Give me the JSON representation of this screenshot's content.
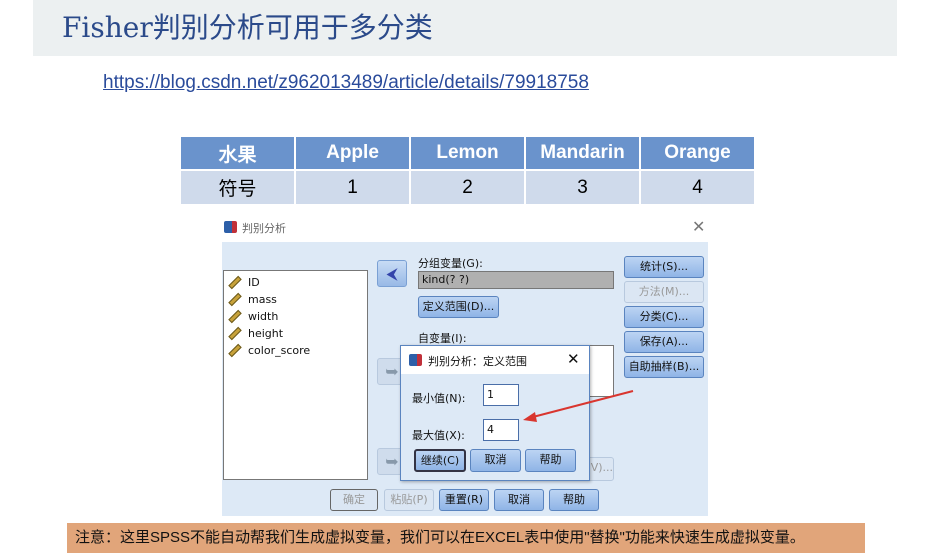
{
  "slide": {
    "title": "Fisher判别分析可用于多分类",
    "link": "https://blog.csdn.net/z962013489/article/details/79918758",
    "note": "注意：这里SPSS不能自动帮我们生成虚拟变量，我们可以在EXCEL表中使用\"替换\"功能来快速生成虚拟变量。"
  },
  "table": {
    "headers": [
      "水果",
      "Apple",
      "Lemon",
      "Mandarin",
      "Orange"
    ],
    "row": [
      "符号",
      "1",
      "2",
      "3",
      "4"
    ]
  },
  "dialog": {
    "title": "判别分析",
    "variables": [
      "ID",
      "mass",
      "width",
      "height",
      "color_score"
    ],
    "grouping_label": "分组变量(G):",
    "grouping_value": "kind(? ?)",
    "define_range": "定义范围(D)...",
    "independent_label": "自变量(I):",
    "side_buttons": [
      "统计(S)...",
      "方法(M)...",
      "分类(C)...",
      "保存(A)...",
      "自助抽样(B)..."
    ],
    "hidden_button": "V)...",
    "bottom_buttons": [
      "确定",
      "粘贴(P)",
      "重置(R)",
      "取消",
      "帮助"
    ]
  },
  "subdialog": {
    "title": "判别分析：定义范围",
    "min_label": "最小值(N):",
    "min_value": "1",
    "max_label": "最大值(X):",
    "max_value": "4",
    "buttons": [
      "继续(C)",
      "取消",
      "帮助"
    ]
  },
  "colors": {
    "header": "#6a93cc",
    "row": "#cfdaeb",
    "note": "#e1a57a",
    "arrow": "#d9362f"
  }
}
